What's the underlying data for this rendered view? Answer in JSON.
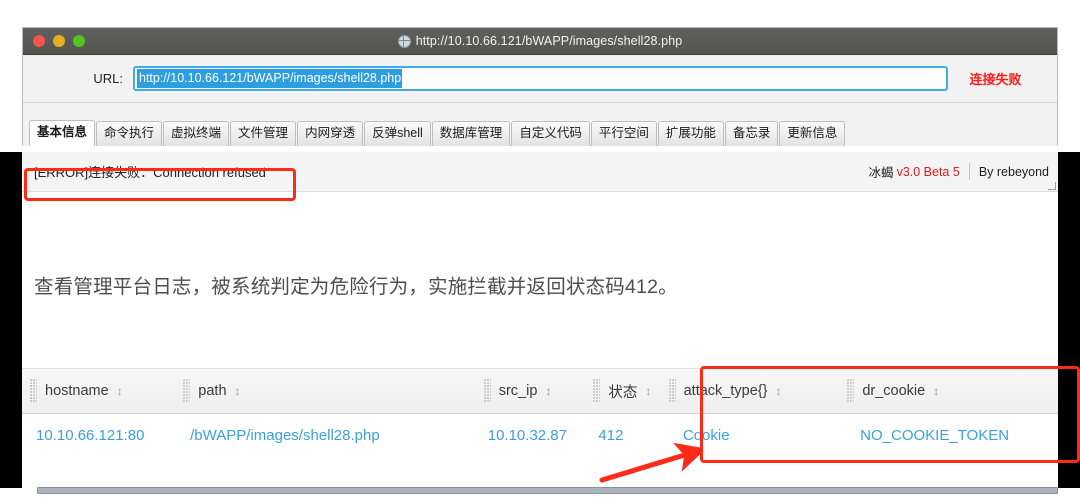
{
  "window": {
    "title": "http://10.10.66.121/bWAPP/images/shell28.php",
    "globe_icon": "globe-icon",
    "traffic_lights": [
      "close-red",
      "minimize-yellow",
      "zoom-green"
    ]
  },
  "url_bar": {
    "label": "URL:",
    "value": "http://10.10.66.121/bWAPP/images/shell28.php",
    "placeholder": "http://",
    "status": "连接失败"
  },
  "tabs": [
    {
      "label": "基本信息",
      "active": true
    },
    {
      "label": "命令执行",
      "active": false
    },
    {
      "label": "虚拟终端",
      "active": false
    },
    {
      "label": "文件管理",
      "active": false
    },
    {
      "label": "内网穿透",
      "active": false
    },
    {
      "label": "反弹shell",
      "active": false
    },
    {
      "label": "数据库管理",
      "active": false
    },
    {
      "label": "自定义代码",
      "active": false
    },
    {
      "label": "平行空间",
      "active": false
    },
    {
      "label": "扩展功能",
      "active": false
    },
    {
      "label": "备忘录",
      "active": false
    },
    {
      "label": "更新信息",
      "active": false
    }
  ],
  "status_strip": {
    "error": "[ERROR]连接失败：Connection refused",
    "product": "冰蝎",
    "version": "v3.0 Beta 5",
    "author": "By rebeyond"
  },
  "body": {
    "sentence": "查看管理平台日志，被系统判定为危险行为，实施拦截并返回状态码412。"
  },
  "table": {
    "columns": [
      {
        "label": "hostname",
        "sort": "↕"
      },
      {
        "label": "path",
        "sort": "↕"
      },
      {
        "label": "src_ip",
        "sort": "↕"
      },
      {
        "label": "状态",
        "sort": "↕"
      },
      {
        "label": "attack_type{}",
        "sort": "↕"
      },
      {
        "label": "dr_cookie",
        "sort": "↕"
      }
    ],
    "rows": [
      {
        "hostname": "10.10.66.121:80",
        "path": "/bWAPP/images/shell28.php",
        "src_ip": "10.10.32.87",
        "status": "412",
        "attack_type": "Cookie",
        "dr_cookie": "NO_COOKIE_TOKEN"
      }
    ]
  },
  "annotations": {
    "color": "#fc2b18",
    "boxes": [
      "error-message-highlight",
      "attack-columns-highlight"
    ],
    "arrow": "pointer-arrow-to-attack-type"
  },
  "colors": {
    "link_blue": "#3aa0dc",
    "error_red": "#ff1a1a",
    "annotation_red": "#fc2b18",
    "selection_blue": "#2d9fe0",
    "version_red": "#d11f1f"
  }
}
